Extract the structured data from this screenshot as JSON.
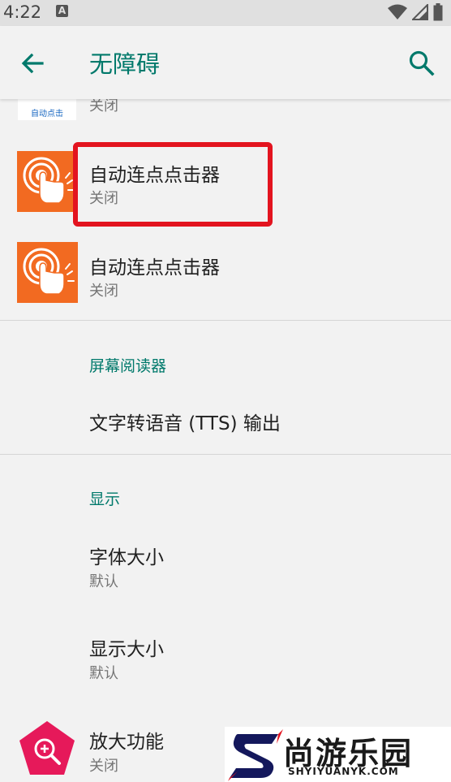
{
  "status_bar": {
    "time": "4:22",
    "notification_letter": "A"
  },
  "toolbar": {
    "title": "无障碍"
  },
  "items": {
    "partial_app": {
      "icon_text": "自动点击",
      "status": "关闭"
    },
    "auto_clicker_1": {
      "title": "自动连点点击器",
      "status": "关闭"
    },
    "auto_clicker_2": {
      "title": "自动连点点击器",
      "status": "关闭"
    },
    "screen_reader_header": "屏幕阅读器",
    "tts": {
      "title": "文字转语音 (TTS) 输出"
    },
    "display_header": "显示",
    "font_size": {
      "title": "字体大小",
      "value": "默认"
    },
    "display_size": {
      "title": "显示大小",
      "value": "默认"
    },
    "magnification": {
      "title": "放大功能",
      "status": "关闭"
    }
  },
  "watermark": {
    "text": "尚游乐园",
    "sub": "SHYIYUANYK.COM"
  },
  "colors": {
    "accent": "#00796b",
    "highlight": "#e3141f",
    "app_orange": "#f26a21",
    "magnify_pink": "#e6195a"
  }
}
